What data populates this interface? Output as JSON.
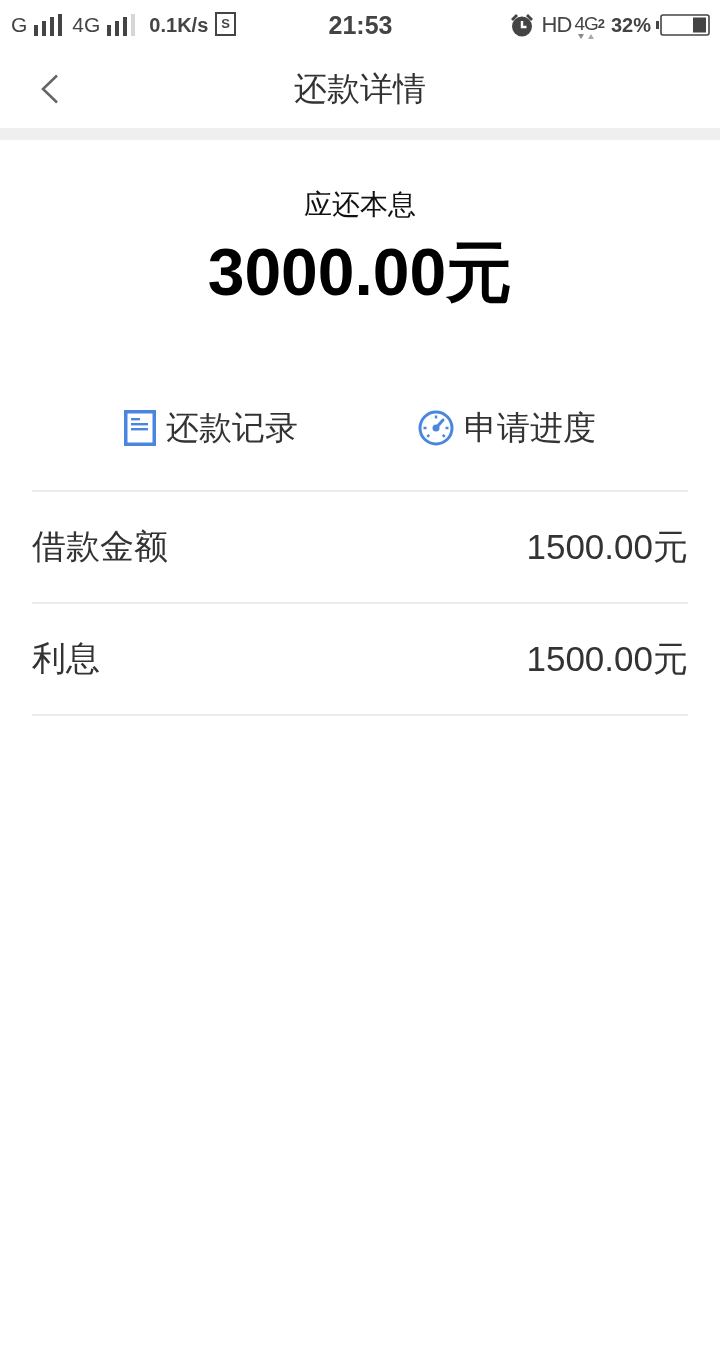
{
  "status_bar": {
    "sim1_network": "G",
    "sim2_network": "4G",
    "net_speed": "0.1K/s",
    "app_badge": "S",
    "time": "21:53",
    "hd_label": "HD",
    "data_network": "4G",
    "data_sim": "2",
    "battery_percent": "32%"
  },
  "nav": {
    "title": "还款详情"
  },
  "summary": {
    "label": "应还本息",
    "amount": "3000.00元"
  },
  "actions": [
    {
      "kind": "document",
      "label": "还款记录"
    },
    {
      "kind": "gauge",
      "label": "申请进度"
    }
  ],
  "details": [
    {
      "label": "借款金额",
      "value": "1500.00元"
    },
    {
      "label": "利息",
      "value": "1500.00元"
    }
  ]
}
